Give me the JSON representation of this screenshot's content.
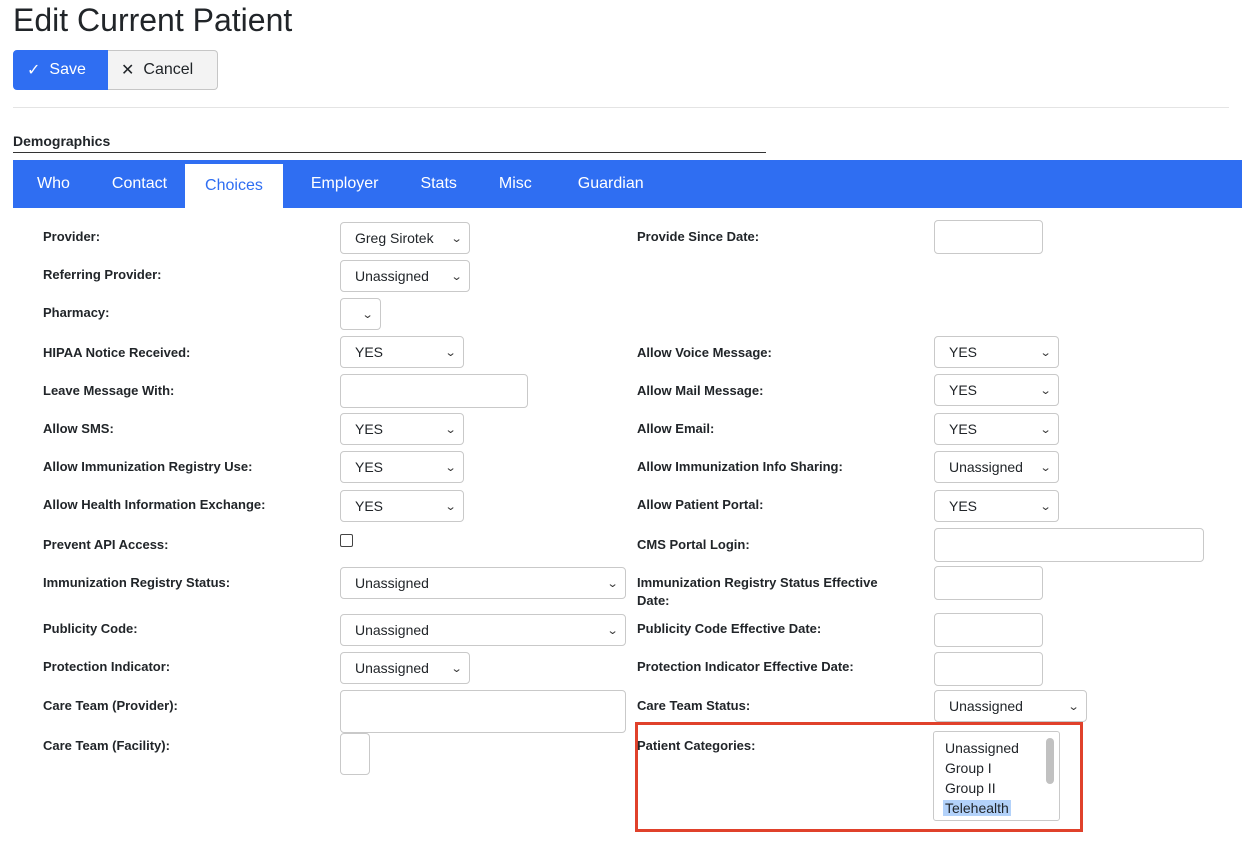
{
  "page": {
    "title": "Edit Current Patient"
  },
  "toolbar": {
    "save_label": "Save",
    "save_icon": "✓",
    "cancel_label": "Cancel",
    "cancel_icon": "✕"
  },
  "section": {
    "title": "Demographics"
  },
  "tabs": [
    {
      "label": "Who"
    },
    {
      "label": "Contact"
    },
    {
      "label": "Choices",
      "active": true
    },
    {
      "label": "Employer"
    },
    {
      "label": "Stats"
    },
    {
      "label": "Misc"
    },
    {
      "label": "Guardian"
    }
  ],
  "left": {
    "provider": {
      "label": "Provider:",
      "value": "Greg Sirotek"
    },
    "referring_provider": {
      "label": "Referring Provider:",
      "value": "Unassigned"
    },
    "pharmacy": {
      "label": "Pharmacy:",
      "value": ""
    },
    "hipaa": {
      "label": "HIPAA Notice Received:",
      "value": "YES"
    },
    "leave_message": {
      "label": "Leave Message With:",
      "value": ""
    },
    "allow_sms": {
      "label": "Allow SMS:",
      "value": "YES"
    },
    "allow_imm_registry": {
      "label": "Allow Immunization Registry Use:",
      "value": "YES"
    },
    "allow_hie": {
      "label": "Allow Health Information Exchange:",
      "value": "YES"
    },
    "prevent_api": {
      "label": "Prevent API Access:",
      "checked": false
    },
    "imm_registry_status": {
      "label": "Immunization Registry Status:",
      "value": "Unassigned"
    },
    "publicity_code": {
      "label": "Publicity Code:",
      "value": "Unassigned"
    },
    "protection_indicator": {
      "label": "Protection Indicator:",
      "value": "Unassigned"
    },
    "care_team_provider": {
      "label": "Care Team (Provider):",
      "value": ""
    },
    "care_team_facility": {
      "label": "Care Team (Facility):",
      "value": ""
    }
  },
  "right": {
    "provide_since": {
      "label": "Provide Since Date:",
      "value": ""
    },
    "allow_voice": {
      "label": "Allow Voice Message:",
      "value": "YES"
    },
    "allow_mail": {
      "label": "Allow Mail Message:",
      "value": "YES"
    },
    "allow_email": {
      "label": "Allow Email:",
      "value": "YES"
    },
    "allow_imm_sharing": {
      "label": "Allow Immunization Info Sharing:",
      "value": "Unassigned"
    },
    "allow_portal": {
      "label": "Allow Patient Portal:",
      "value": "YES"
    },
    "cms_portal_login": {
      "label": "CMS Portal Login:",
      "value": ""
    },
    "imm_status_date": {
      "label_line1": "Immunization Registry Status Effective",
      "label_line2": "Date:",
      "value": ""
    },
    "publicity_date": {
      "label": "Publicity Code Effective Date:",
      "value": ""
    },
    "protection_date": {
      "label": "Protection Indicator Effective Date:",
      "value": ""
    },
    "care_team_status": {
      "label": "Care Team Status:",
      "value": "Unassigned"
    },
    "patient_categories": {
      "label": "Patient Categories:",
      "options": [
        "Unassigned",
        "Group I",
        "Group II",
        "Telehealth"
      ],
      "selected": "Telehealth"
    }
  },
  "colors": {
    "accent": "#2f6ef2",
    "highlight_box": "#e0412b",
    "selected_option": "#b3d2fa"
  },
  "icons": {
    "chevron": "chevron-down-icon"
  }
}
